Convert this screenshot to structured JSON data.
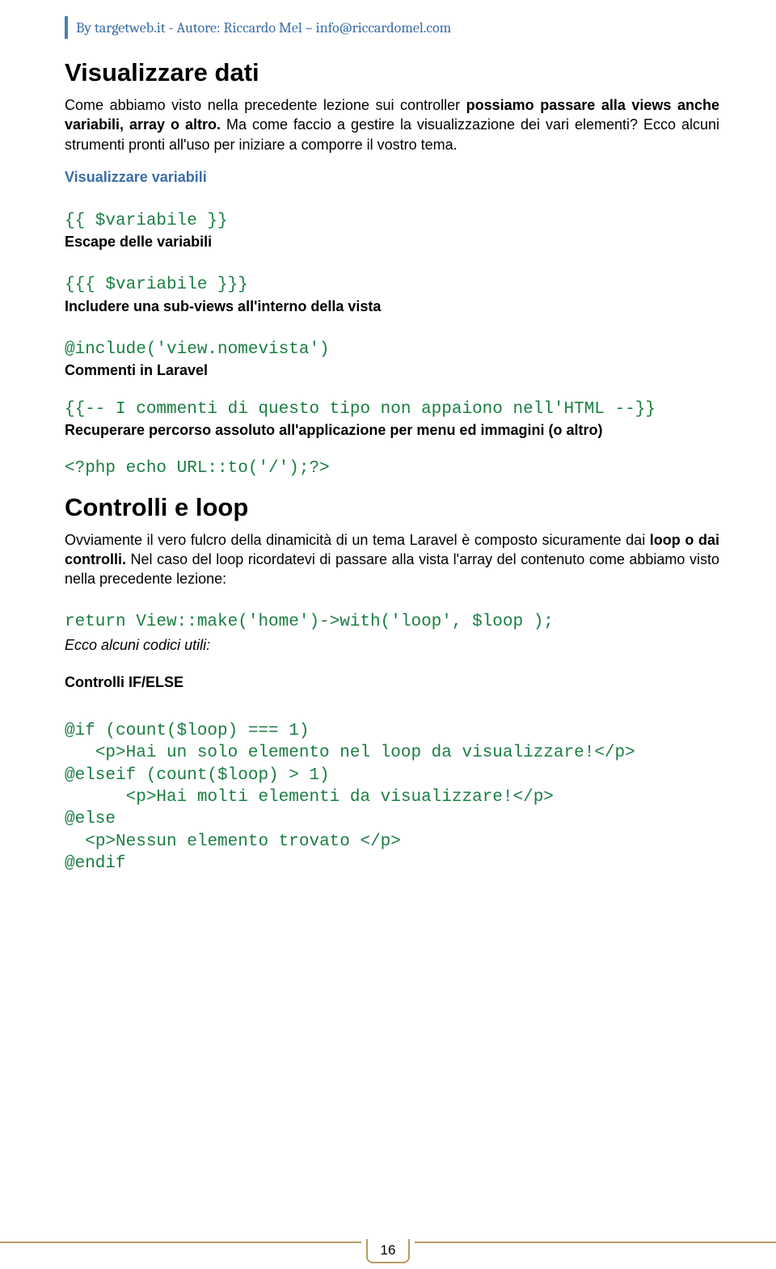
{
  "header": {
    "text": "By targetweb.it - Autore: Riccardo Mel – info@riccardomel.com"
  },
  "sections": {
    "heading1": "Visualizzare dati",
    "intro_prefix": "Come abbiamo visto nella precedente lezione sui controller ",
    "intro_bold": "possiamo passare alla views anche variabili, array o altro.",
    "intro_suffix": " Ma come faccio a gestire la visualizzazione dei vari elementi? Ecco alcuni strumenti pronti all'uso per iniziare a comporre il vostro tema.",
    "sub1": "Visualizzare variabili",
    "code1": "{{ $variabile }}",
    "sub2": "Escape delle variabili",
    "code2": "{{{ $variabile }}}",
    "sub3": "Includere una sub-views all'interno della vista",
    "code3": "@include('view.nomevista')",
    "sub4": "Commenti in Laravel",
    "code4": "{{-- I commenti di questo tipo non appaiono nell'HTML --}}",
    "sub5": "Recuperare percorso assoluto all'applicazione per menu ed immagini (o altro)",
    "code5": "<?php echo URL::to('/');?>",
    "heading2": "Controlli e loop",
    "p2_prefix": "Ovviamente il vero fulcro della dinamicità di un tema Laravel è composto sicuramente dai ",
    "p2_bold": "loop o dai controlli.",
    "p2_suffix": " Nel caso del loop ricordatevi di passare alla vista l'array del contenuto come abbiamo visto nella precedente lezione:",
    "code6": "return View::make('home')->with('loop', $loop );",
    "italic_note": " Ecco alcuni codici utili:",
    "sub6": "Controlli IF/ELSE",
    "code7": "@if (count($loop) === 1)\n   <p>Hai un solo elemento nel loop da visualizzare!</p>\n@elseif (count($loop) > 1)\n      <p>Hai molti elementi da visualizzare!</p>\n@else\n  <p>Nessun elemento trovato </p>\n@endif"
  },
  "footer": {
    "page_number": "16"
  }
}
